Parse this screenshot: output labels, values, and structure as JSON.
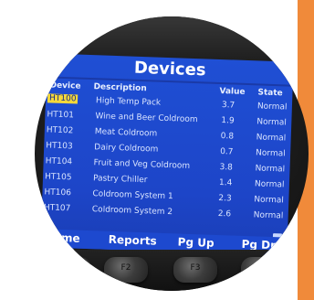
{
  "screen": {
    "title": "Devices",
    "columns": {
      "device": "Device",
      "description": "Description",
      "value": "Value",
      "state": "State"
    },
    "rows": [
      {
        "device": "HT100",
        "description": "High Temp Pack",
        "value": "3.7",
        "state": "Normal"
      },
      {
        "device": "HT101",
        "description": "Wine and Beer Coldroom",
        "value": "1.9",
        "state": "Normal"
      },
      {
        "device": "HT102",
        "description": "Meat Coldroom",
        "value": "0.8",
        "state": "Normal"
      },
      {
        "device": "HT103",
        "description": "Dairy Coldroom",
        "value": "0.7",
        "state": "Normal"
      },
      {
        "device": "HT104",
        "description": "Fruit and Veg Coldroom",
        "value": "3.8",
        "state": "Normal"
      },
      {
        "device": "HT105",
        "description": "Pastry Chiller",
        "value": "1.4",
        "state": "Normal"
      },
      {
        "device": "HT106",
        "description": "Coldroom System 1",
        "value": "2.3",
        "state": "Normal"
      },
      {
        "device": "HT107",
        "description": "Coldroom System 2",
        "value": "2.6",
        "state": "Normal"
      }
    ],
    "footer": {
      "home": "Home",
      "reports": "Reports",
      "pgup": "Pg Up",
      "pgdn": "Pg Dn"
    }
  },
  "keys": {
    "f2": "F2",
    "f3": "F3"
  },
  "colors": {
    "screen": "#1f4fd4",
    "highlight": "#f5d83a",
    "accent_bar": "#f08a3a"
  }
}
